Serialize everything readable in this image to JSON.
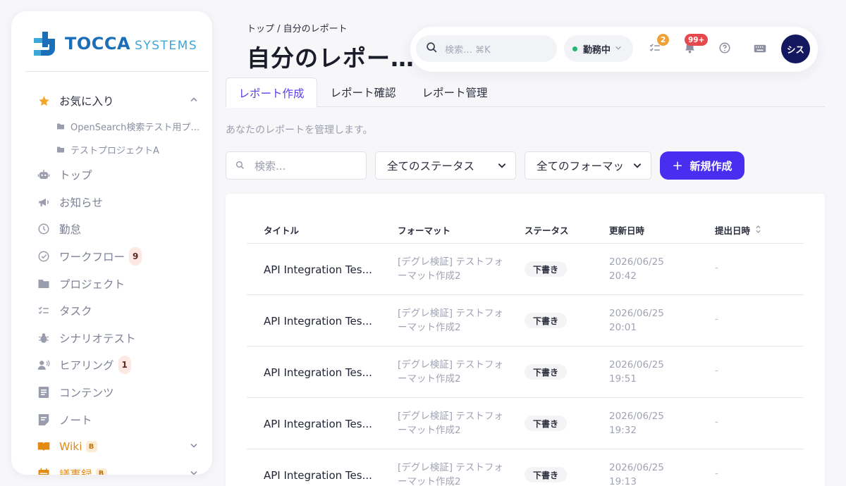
{
  "brand": {
    "name": "TOCCA",
    "suffix": "SYSTEMS"
  },
  "sidebar": {
    "favorites": {
      "label": "お気に入り",
      "items": [
        {
          "label": "OpenSearch検索テスト用プ…"
        },
        {
          "label": "テストプロジェクトA"
        }
      ]
    },
    "items": [
      {
        "label": "トップ"
      },
      {
        "label": "お知らせ"
      },
      {
        "label": "勤怠"
      },
      {
        "label": "ワークフロー",
        "badge": "9"
      },
      {
        "label": "プロジェクト"
      },
      {
        "label": "タスク"
      },
      {
        "label": "シナリオテスト"
      },
      {
        "label": "ヒアリング",
        "badge": "1"
      },
      {
        "label": "コンテンツ"
      },
      {
        "label": "ノート"
      },
      {
        "label": "Wiki",
        "tag": "B"
      },
      {
        "label": "議事録",
        "tag": "B"
      }
    ]
  },
  "header": {
    "breadcrumb": "トップ  /  自分のレポート",
    "title": "自分のレポー…",
    "search_placeholder": "検索… ⌘K",
    "status": "勤務中",
    "tasks_badge": "2",
    "notifications_badge": "99+",
    "avatar": "シス"
  },
  "tabs": [
    {
      "label": "レポート作成"
    },
    {
      "label": "レポート確認"
    },
    {
      "label": "レポート管理"
    }
  ],
  "subtitle": "あなたのレポートを管理します。",
  "filters": {
    "search_placeholder": "検索...",
    "status_select": "全てのステータス",
    "format_select": "全てのフォーマッ",
    "new_button": "新規作成"
  },
  "table": {
    "columns": {
      "title": "タイトル",
      "format": "フォーマット",
      "status": "ステータス",
      "updated": "更新日時",
      "submitted": "提出日時"
    },
    "rows": [
      {
        "title": "API Integration Tes...",
        "format": "[デグレ検証] テストフォーマット作成2",
        "status": "下書き",
        "updated_date": "2026/06/25",
        "updated_time": "20:42",
        "submitted": "-"
      },
      {
        "title": "API Integration Tes...",
        "format": "[デグレ検証] テストフォーマット作成2",
        "status": "下書き",
        "updated_date": "2026/06/25",
        "updated_time": "20:01",
        "submitted": "-"
      },
      {
        "title": "API Integration Tes...",
        "format": "[デグレ検証] テストフォーマット作成2",
        "status": "下書き",
        "updated_date": "2026/06/25",
        "updated_time": "19:51",
        "submitted": "-"
      },
      {
        "title": "API Integration Tes...",
        "format": "[デグレ検証] テストフォーマット作成2",
        "status": "下書き",
        "updated_date": "2026/06/25",
        "updated_time": "19:32",
        "submitted": "-"
      },
      {
        "title": "API Integration Tes...",
        "format": "[デグレ検証] テストフォーマット作成2",
        "status": "下書き",
        "updated_date": "2026/06/25",
        "updated_time": "19:13",
        "submitted": "-"
      }
    ]
  },
  "colors": {
    "accent": "#4a2ef0",
    "brand": "#1a6fb8",
    "favorite": "#f5a623",
    "online": "#22b573",
    "avatar_bg": "#14185e"
  }
}
